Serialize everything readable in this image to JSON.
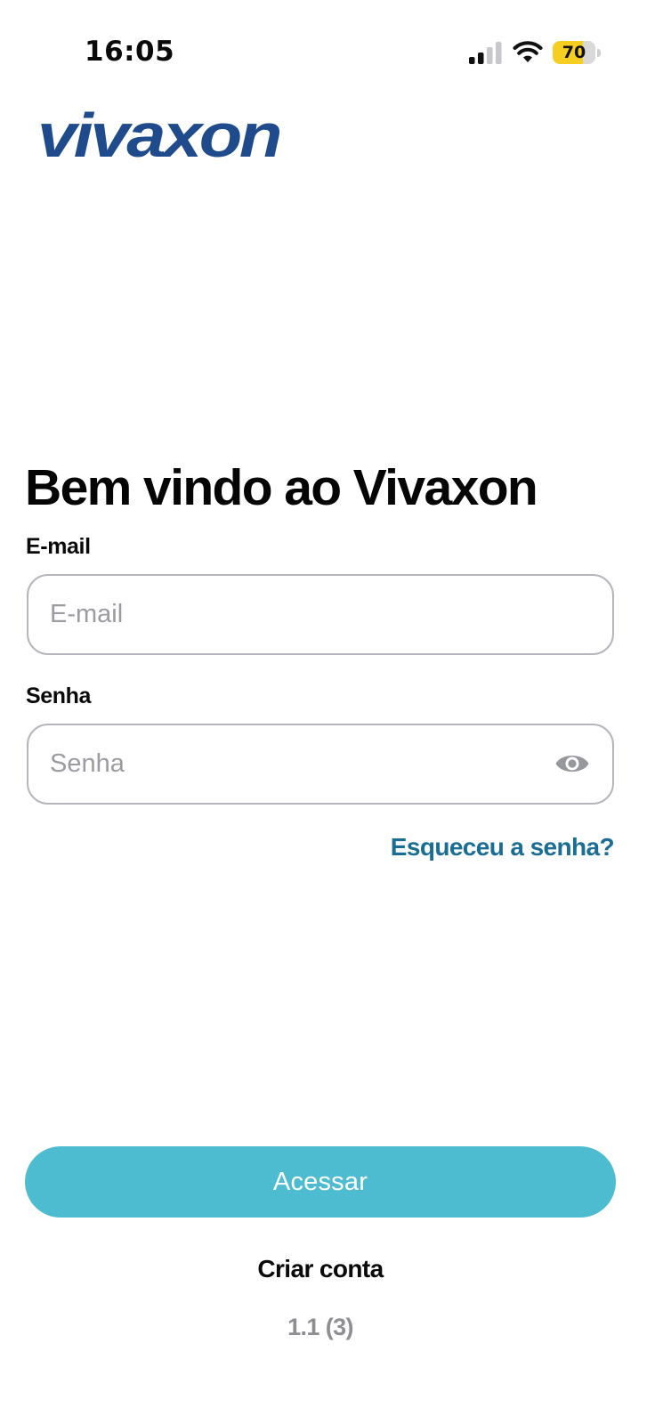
{
  "status_bar": {
    "time": "16:05",
    "signal_icon": "cellular-signal-icon",
    "wifi_icon": "wifi-icon",
    "battery_level": "70",
    "battery_fraction": 0.7,
    "battery_color": "#f5ce21"
  },
  "brand": {
    "logo_text": "vivaxon",
    "logo_color": "#1f4b8c"
  },
  "login": {
    "title": "Bem vindo ao Vivaxon",
    "email_label": "E-mail",
    "email_placeholder": "E-mail",
    "email_value": "",
    "password_label": "Senha",
    "password_placeholder": "Senha",
    "password_value": "",
    "password_toggle_icon": "eye-icon",
    "forgot_password": "Esqueceu a senha?",
    "submit_label": "Acessar",
    "create_account": "Criar conta",
    "version": "1.1 (3)"
  },
  "colors": {
    "accent": "#4dbcd1",
    "link": "#1a6d95",
    "muted": "#8e8e93"
  }
}
